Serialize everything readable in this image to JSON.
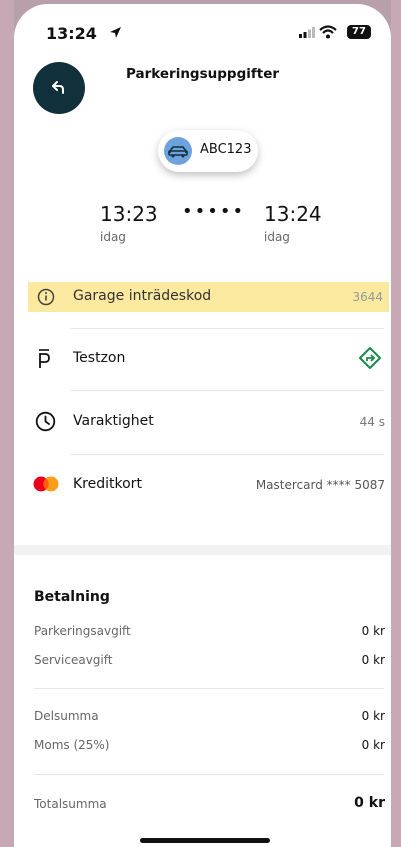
{
  "status_bar": {
    "time": "13:24",
    "battery": "77"
  },
  "header": {
    "title": "Parkeringsuppgifter"
  },
  "plate": {
    "number": "ABC123"
  },
  "times": {
    "start": "13:23",
    "start_label": "idag",
    "end": "13:24",
    "end_label": "idag",
    "separator": "•••••"
  },
  "rows": {
    "garage": {
      "label": "Garage inträdeskod",
      "value": "3644"
    },
    "zone": {
      "label": "Testzon"
    },
    "duration": {
      "label": "Varaktighet",
      "value": "44 s"
    },
    "payment": {
      "label": "Kreditkort",
      "value": "Mastercard **** 5087"
    }
  },
  "payment_summary": {
    "title": "Betalning",
    "items": [
      {
        "label": "Parkeringsavgift",
        "value": "0 kr"
      },
      {
        "label": "Serviceavgift",
        "value": "0 kr"
      },
      {
        "label": "Delsumma",
        "value": "0 kr"
      },
      {
        "label": "Moms (25%)",
        "value": "0 kr"
      }
    ],
    "total_label": "Totalsumma",
    "total_value": "0 kr"
  },
  "icons": {
    "back": "back-arrow-icon",
    "car": "car-icon",
    "info": "info-icon",
    "parking": "parking-icon",
    "directions": "directions-icon",
    "clock": "clock-icon",
    "card": "mastercard-icon"
  },
  "colors": {
    "back_button": "#10303c",
    "garage_highlight": "#fbe9a0",
    "directions": "#1a8a4a",
    "car_badge": "#6ea2dc"
  }
}
